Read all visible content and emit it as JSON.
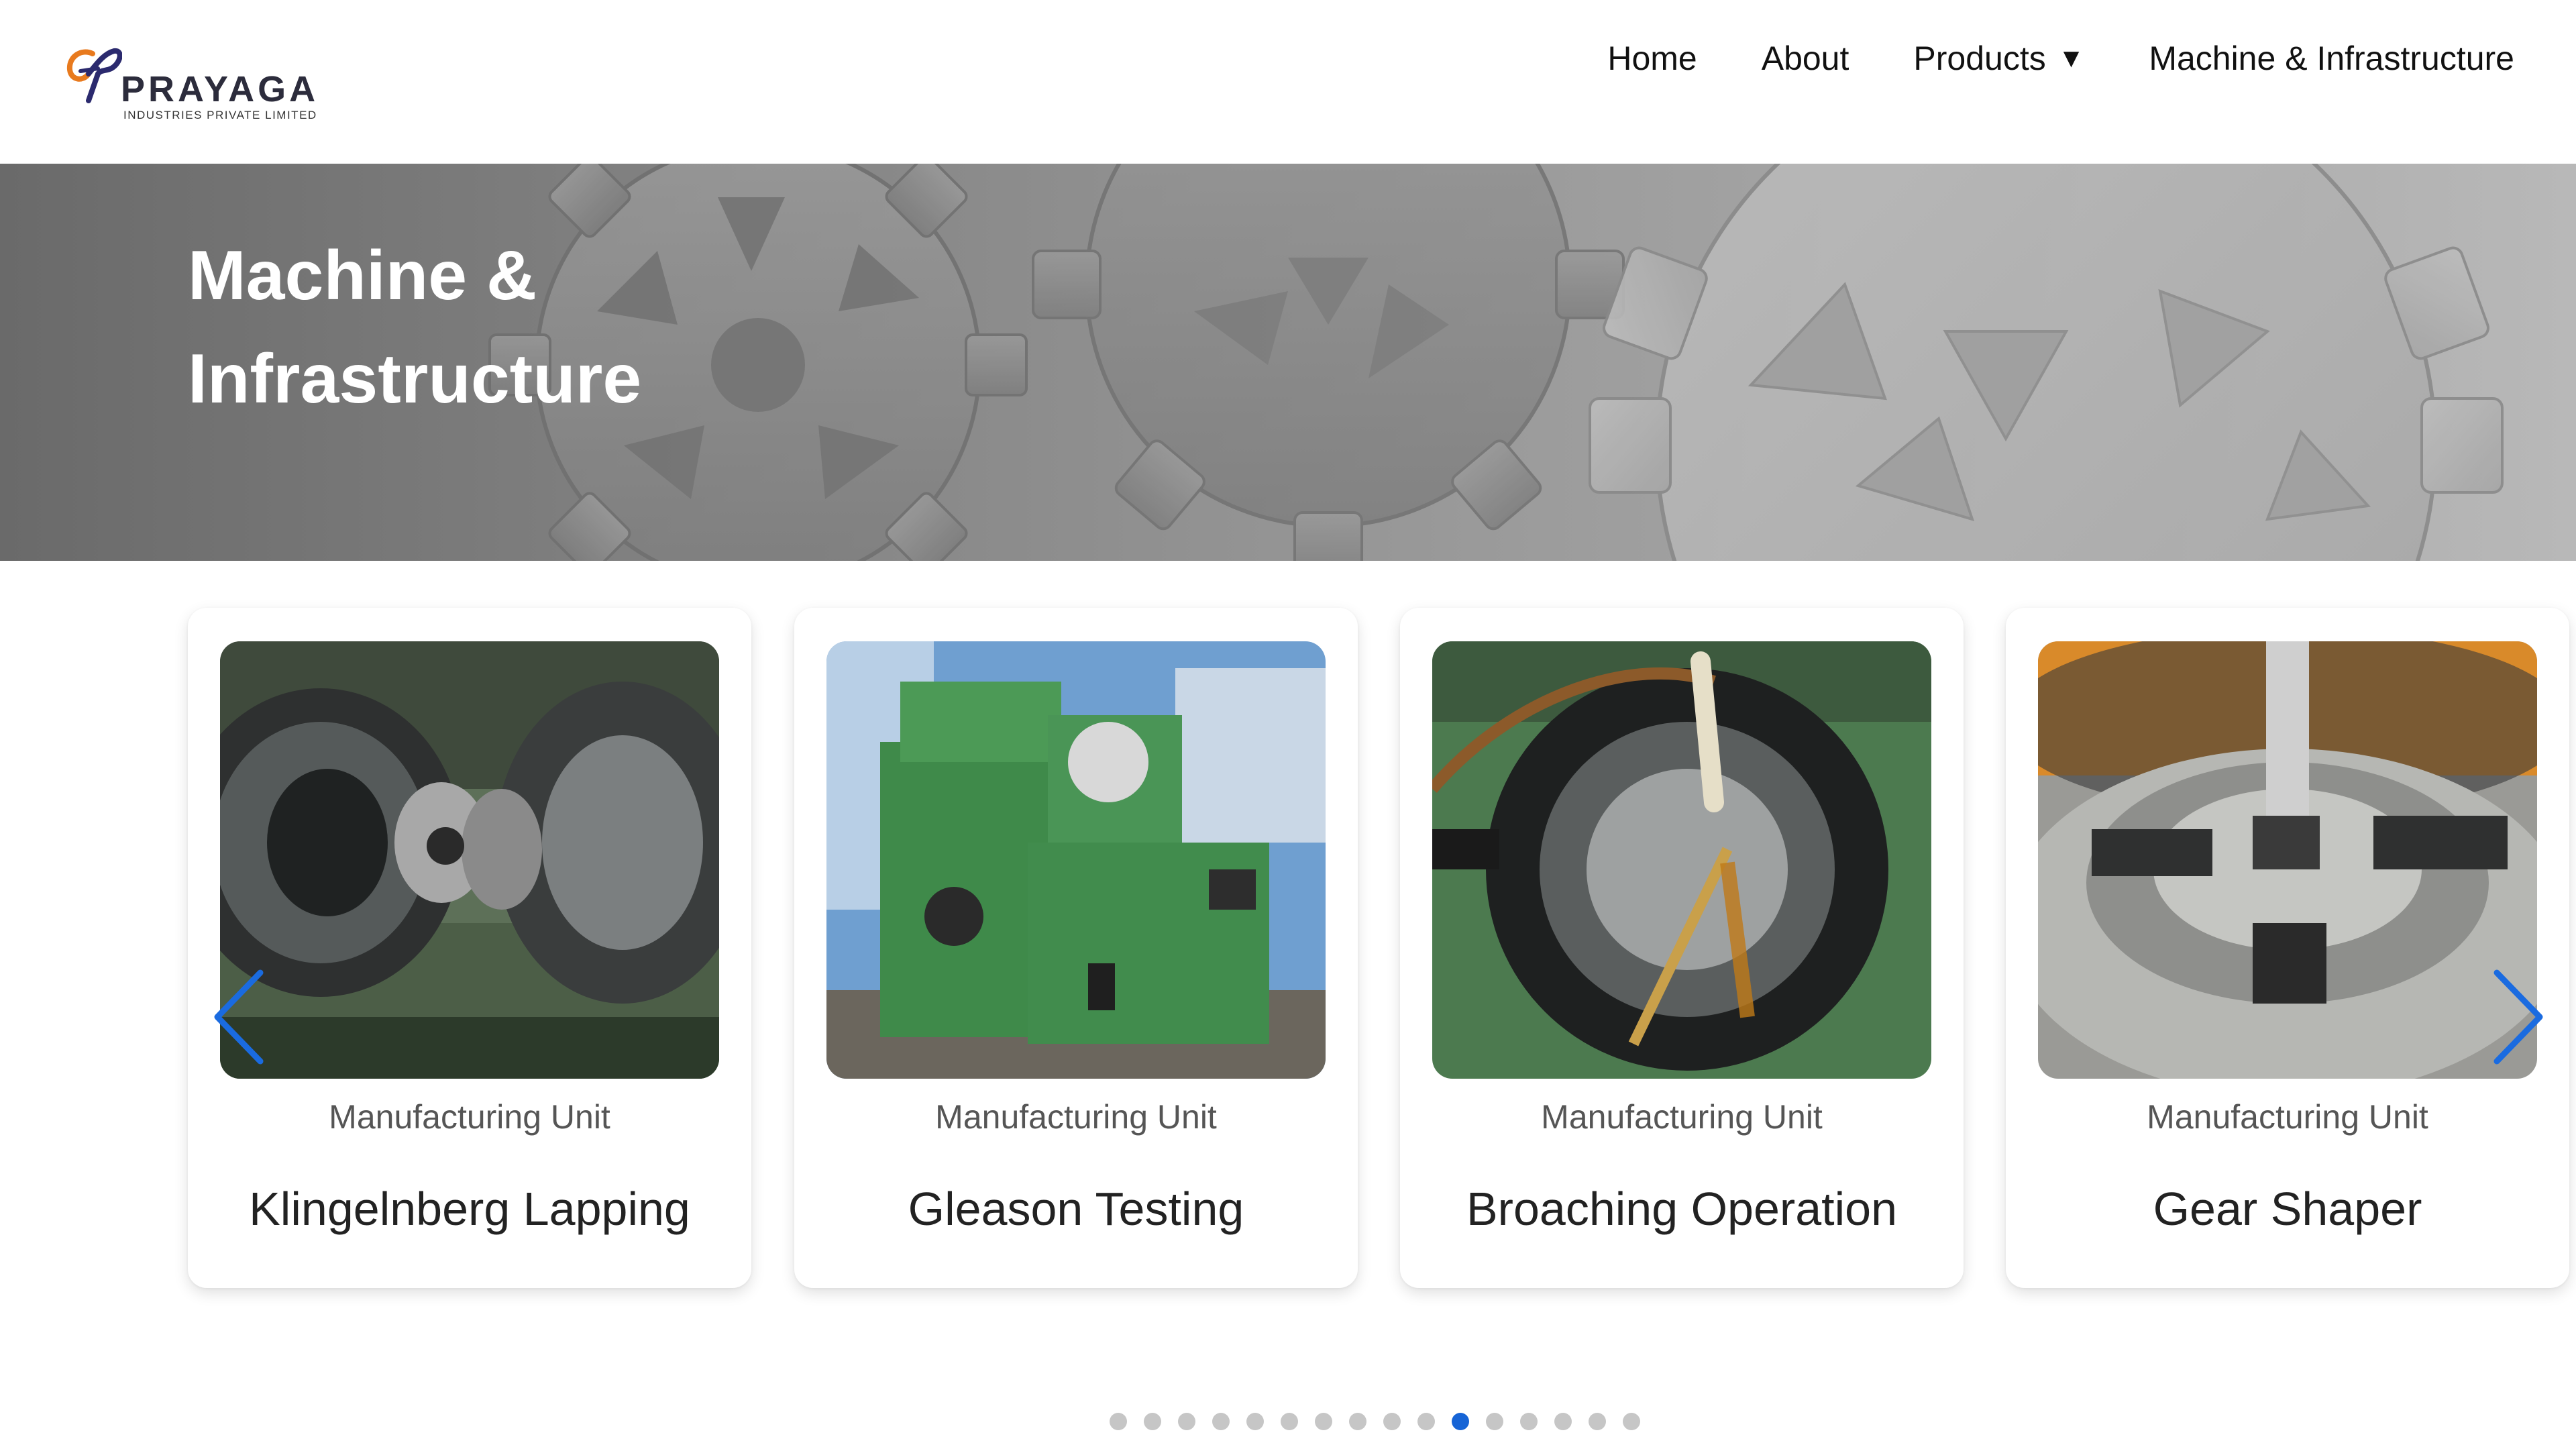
{
  "brand": {
    "name": "PRAYAGA",
    "tagline": "INDUSTRIES PRIVATE LIMITED"
  },
  "nav": {
    "items": [
      {
        "label": "Home"
      },
      {
        "label": "About"
      },
      {
        "label": "Products",
        "caret": "▼"
      },
      {
        "label": "Machine & Infrastructure"
      }
    ]
  },
  "hero": {
    "title_line1": "Machine &",
    "title_line2": "Infrastructure"
  },
  "carousel": {
    "cards": [
      {
        "tag": "Manufacturing Unit",
        "title": "Klingelnberg Lapping",
        "icon": "bevel-gear-lapping-photo"
      },
      {
        "tag": "Manufacturing Unit",
        "title": "Gleason Testing",
        "icon": "green-machine-photo"
      },
      {
        "tag": "Manufacturing Unit",
        "title": "Broaching Operation",
        "icon": "broaching-photo"
      },
      {
        "tag": "Manufacturing Unit",
        "title": "Gear Shaper",
        "icon": "chuck-photo"
      }
    ],
    "dot_count": 16,
    "active_dot": 10,
    "accent_color": "#1664d6",
    "arrow_color": "#1a6be0"
  }
}
